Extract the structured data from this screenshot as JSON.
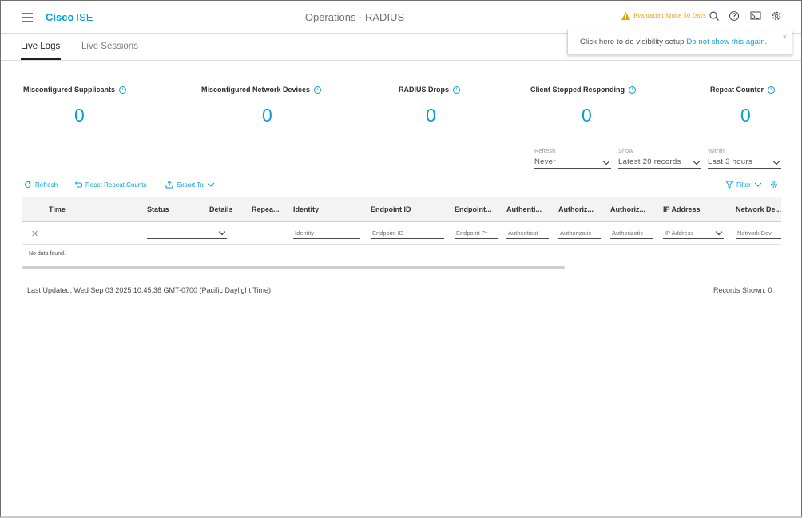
{
  "header": {
    "brand_bold": "Cisco",
    "brand_light": "ISE",
    "title": "Operations · RADIUS",
    "eval_text": "Evaluation Mode 50 Days",
    "icons": [
      "search-icon",
      "help-icon",
      "notifications-icon",
      "settings-icon"
    ],
    "accent_color": "#049fd9",
    "warning_color": "#e89e00"
  },
  "popup": {
    "message": "Click here to do visibility setup",
    "link": "Do not show this again.",
    "close": "×"
  },
  "tabs": [
    {
      "label": "Live Logs",
      "active": true
    },
    {
      "label": "Live Sessions",
      "active": false
    }
  ],
  "metrics": [
    {
      "label": "Misconfigured Supplicants",
      "value": "0"
    },
    {
      "label": "Misconfigured Network Devices",
      "value": "0"
    },
    {
      "label": "RADIUS Drops",
      "value": "0"
    },
    {
      "label": "Client Stopped Responding",
      "value": "0"
    },
    {
      "label": "Repeat Counter",
      "value": "0"
    }
  ],
  "controls": {
    "refresh": {
      "caption": "Refresh",
      "value": "Never"
    },
    "show": {
      "caption": "Show",
      "value": "Latest 20 records"
    },
    "within": {
      "caption": "Within",
      "value": "Last 3 hours"
    }
  },
  "toolbar": {
    "refresh": "Refresh",
    "reset": "Reset Repeat Counts",
    "export": "Export To",
    "filter": "Filter"
  },
  "table": {
    "columns": [
      "Time",
      "Status",
      "Details",
      "Repea...",
      "Identity",
      "Endpoint ID",
      "Endpoint...",
      "Authenti...",
      "Authoriz...",
      "Authoriz...",
      "IP Address",
      "Network De..."
    ],
    "filters": [
      "Identity",
      "Endpoint ID",
      "Endpoint Pr",
      "Authenticat",
      "Authorizatic",
      "Authorizatic",
      "IP Address",
      "Network Devi"
    ],
    "empty_message": "No data found."
  },
  "footer": {
    "last_updated": "Last Updated: Wed Sep 03 2025 10:45:38 GMT-0700 (Pacific Daylight Time)",
    "records_shown": "Records Shown: 0"
  }
}
